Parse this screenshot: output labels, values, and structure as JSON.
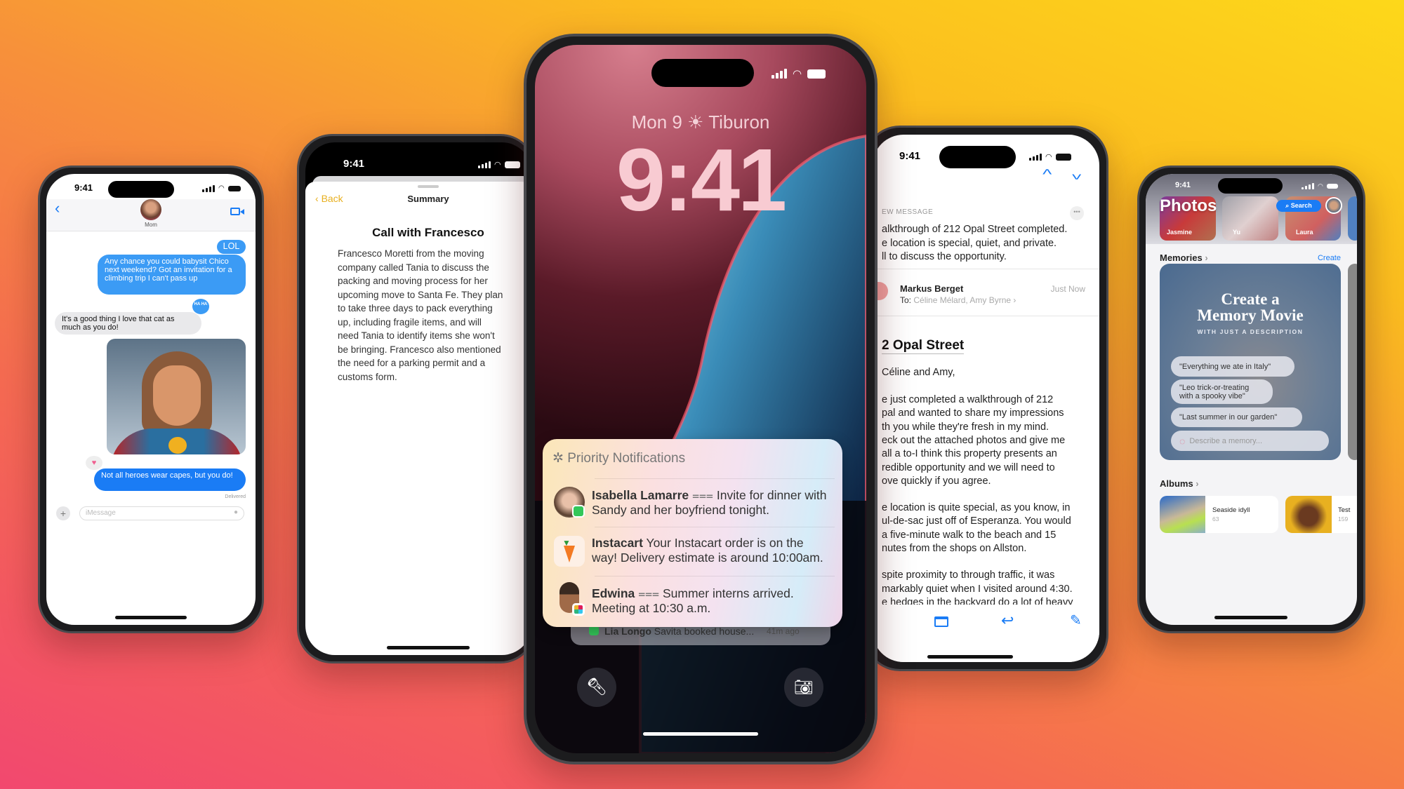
{
  "status_time": "9:41",
  "messages": {
    "contact": "Mom",
    "bubbles": [
      {
        "text": "LOL",
        "from": "me"
      },
      {
        "text": "Any chance you could babysit Chico next weekend? Got an invitation for a climbing trip I can't pass up",
        "from": "me"
      },
      {
        "text": "It's a good thing I love that cat as much as you do!",
        "from": "them"
      },
      {
        "text": "Not all heroes wear capes, but you do!",
        "from": "me"
      }
    ],
    "tapback": "HA HA",
    "delivered": "Delivered",
    "input_placeholder": "iMessage",
    "colors": {
      "bubble_blue": "#3b9bf5",
      "bubble_blue_dark": "#1a7cf5",
      "bubble_gray": "#e9e9eb"
    }
  },
  "notes": {
    "back_label": "Back",
    "nav_title": "Summary",
    "title": "Call with Francesco",
    "body_lines": [
      "Francesco Moretti from the moving",
      "company called Tania to discuss the",
      "packing and moving process for her",
      "upcoming move to Santa Fe. They plan",
      "to take three days to pack everything",
      "up, including fragile items, and will",
      "need Tania to identify items she won't",
      "be bringing. Francesco also mentioned",
      "the need for a parking permit and a",
      "customs form."
    ],
    "accent": "#e8b020"
  },
  "lockscreen": {
    "date": "Mon 9",
    "weather_icon": "sun-icon",
    "location": "Tiburon",
    "time": "9:41",
    "priority_title": "Priority Notifications",
    "notifications": [
      {
        "sender": "Isabella Lamarre",
        "text": "Invite for dinner with",
        "text2": "Sandy and her boyfriend tonight.",
        "summary_icon": true
      },
      {
        "sender": "Instacart",
        "text": "Your Instacart order is on the",
        "text2": "way! Delivery estimate is around 10:00am.",
        "summary_icon": false
      },
      {
        "sender": "Edwina",
        "text": "Summer interns arrived.",
        "text2": "Meeting at 10:30 a.m.",
        "summary_icon": true
      }
    ],
    "stacked": {
      "sender": "Lia Longo",
      "text": "Savita booked house...",
      "time": "41m ago"
    }
  },
  "mail": {
    "summary_label": "EW MESSAGE",
    "summary_lines": [
      "alkthrough of 212 Opal Street completed.",
      "e location is special, quiet, and private.",
      "ll to discuss the opportunity."
    ],
    "sender": "Markus Berget",
    "to_label": "To:",
    "recipients": "Céline Mélard, Amy Byrne",
    "time": "Just Now",
    "subject": "2 Opal Street",
    "greeting": "Céline and Amy,",
    "paragraphs": [
      [
        "e just completed a walkthrough of 212",
        "pal and wanted to share my impressions",
        "th you while they're fresh in my mind.",
        "eck out the attached photos and give me",
        "all a to-I think this property presents an",
        "redible opportunity and we will need to",
        "ove quickly if you agree."
      ],
      [
        "e location is quite special, as you know, in",
        "ul-de-sac just off of Esperanza. You would",
        " a five-minute walk to the beach and 15",
        "nutes from the shops on Allston."
      ],
      [
        "spite proximity to through traffic, it was",
        "markably quiet when I visited around 4:30.",
        "e hedges in the backyard do a lot of heavy"
      ]
    ],
    "accent": "#1a7cf5"
  },
  "photos": {
    "title": "Photos",
    "search_label": "Search",
    "people": [
      "Jasmine",
      "Yu",
      "Laura"
    ],
    "memories_label": "Memories",
    "create_label": "Create",
    "memory_title_1": "Create a",
    "memory_title_2": "Memory Movie",
    "memory_subtitle": "WITH JUST A DESCRIPTION",
    "suggestions": [
      "\"Everything we ate in Italy\"",
      "\"Leo trick-or-treating with a spooky vibe\"",
      "\"Last summer in our garden\""
    ],
    "input_placeholder": "Describe a memory...",
    "albums_label": "Albums",
    "albums": [
      {
        "name": "Seaside idyll",
        "count": "63"
      },
      {
        "name": "Test",
        "count": "159"
      }
    ]
  }
}
